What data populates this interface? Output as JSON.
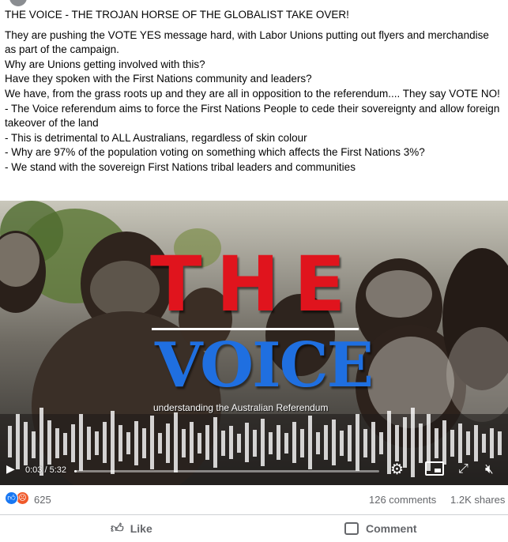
{
  "post": {
    "text_lines": [
      "THE VOICE - THE TROJAN HORSE OF THE GLOBALIST TAKE OVER!",
      "They are pushing the VOTE YES message hard, with Labor Unions putting out flyers and merchandise as part of the campaign.",
      "Why are Unions getting involved with this?",
      "Have they spoken with the First Nations community and leaders?",
      "We have, from the grass roots up and they are all in opposition to the referendum.... They say VOTE NO!",
      "- The Voice referendum aims to force the First Nations People to cede their sovereignty and allow foreign takeover of the land",
      "- This is detrimental to ALL Australians, regardless of skin colour",
      "- Why are 97% of the population voting on something which affects the First Nations 3%?",
      "- We stand with the sovereign First Nations tribal leaders and communities"
    ]
  },
  "video": {
    "title_main": "THE",
    "title_sub": "VOICE",
    "tagline": "understanding the Australian Referendum",
    "time": "0:03 / 5:32",
    "progress_fraction": 0.009,
    "icons": [
      "play-icon",
      "settings-icon",
      "picture-in-picture-icon",
      "fullscreen-icon",
      "volume-muted-icon"
    ],
    "colors": {
      "the": "#e0141d",
      "voice": "#1f6fe0"
    }
  },
  "stats": {
    "reaction_count": "625",
    "reactions": [
      "like-icon",
      "angry-icon"
    ],
    "comments": "126 comments",
    "shares": "1.2K shares"
  },
  "actions": {
    "like_label": "Like",
    "comment_label": "Comment"
  }
}
